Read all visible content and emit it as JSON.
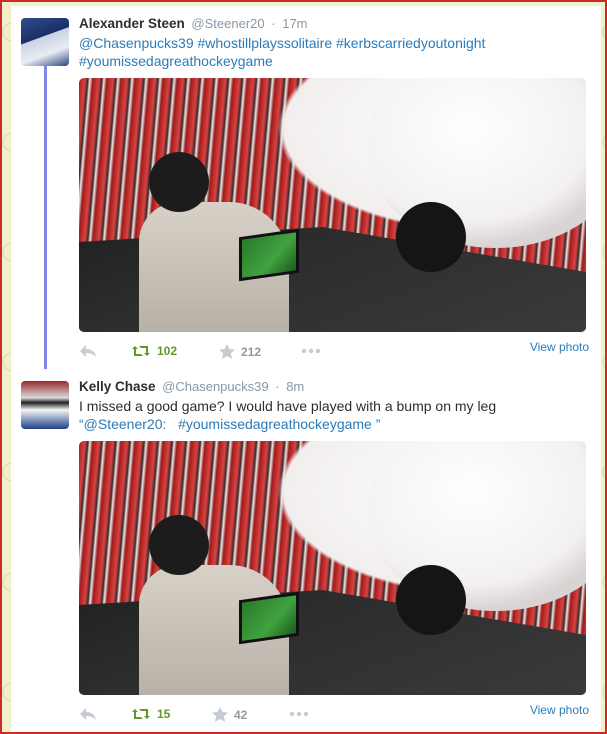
{
  "tweets": [
    {
      "author_name": "Alexander Steen",
      "author_handle": "@Steener20",
      "separator": "·",
      "time": "17m",
      "text_line1": "@Chasenpucks39 #whostillplayssolitaire #kerbscarriedyoutonight",
      "text_line2": "#youmissedagreathockeygame",
      "retweets": "102",
      "favorites": "212",
      "view_photo": "View photo"
    },
    {
      "author_name": "Kelly Chase",
      "author_handle": "@Chasenpucks39",
      "separator": "·",
      "time": "8m",
      "text_line1": "I missed a good game? I would have played with a bump on my leg",
      "quote_open": "“",
      "quote_mention": "@Steener20:",
      "quote_hashtag": "#youmissedagreathockeygame",
      "quote_close": " ”",
      "retweets": "15",
      "favorites": "42",
      "view_photo": "View photo"
    }
  ],
  "colors": {
    "link": "#2b7bb9",
    "retweet_green": "#609928",
    "thread_line": "#7f86e6",
    "border_red": "#cc2b2b"
  },
  "icons": [
    "reply-icon",
    "retweet-icon",
    "favorite-star-icon",
    "more-dots-icon"
  ]
}
